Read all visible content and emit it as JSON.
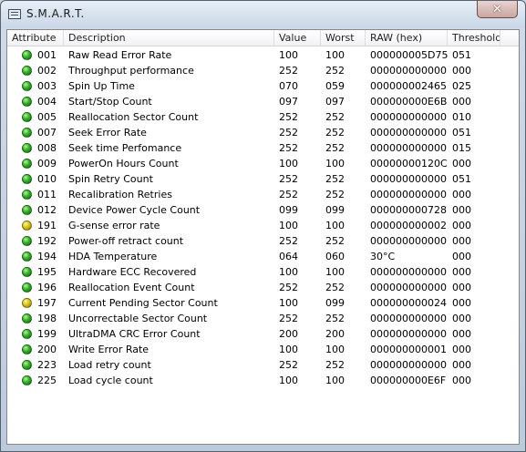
{
  "window": {
    "title": "S.M.A.R.T.",
    "close_label": "✕"
  },
  "columns": [
    "Attribute",
    "Description",
    "Value",
    "Worst",
    "RAW (hex)",
    "Threshold"
  ],
  "colors": {
    "ok": "#33b02a",
    "warning": "#d7c21a"
  },
  "rows": [
    {
      "status": "ok",
      "attr": "001",
      "desc": "Raw Read Error Rate",
      "value": "100",
      "worst": "100",
      "raw": "000000005D75",
      "threshold": "051"
    },
    {
      "status": "ok",
      "attr": "002",
      "desc": "Throughput performance",
      "value": "252",
      "worst": "252",
      "raw": "000000000000",
      "threshold": "000"
    },
    {
      "status": "ok",
      "attr": "003",
      "desc": "Spin Up Time",
      "value": "070",
      "worst": "059",
      "raw": "000000002465",
      "threshold": "025"
    },
    {
      "status": "ok",
      "attr": "004",
      "desc": "Start/Stop Count",
      "value": "097",
      "worst": "097",
      "raw": "000000000E6B",
      "threshold": "000"
    },
    {
      "status": "ok",
      "attr": "005",
      "desc": "Reallocation Sector Count",
      "value": "252",
      "worst": "252",
      "raw": "000000000000",
      "threshold": "010"
    },
    {
      "status": "ok",
      "attr": "007",
      "desc": "Seek Error Rate",
      "value": "252",
      "worst": "252",
      "raw": "000000000000",
      "threshold": "051"
    },
    {
      "status": "ok",
      "attr": "008",
      "desc": "Seek time Perfomance",
      "value": "252",
      "worst": "252",
      "raw": "000000000000",
      "threshold": "015"
    },
    {
      "status": "ok",
      "attr": "009",
      "desc": "PowerOn Hours Count",
      "value": "100",
      "worst": "100",
      "raw": "00000000120C",
      "threshold": "000"
    },
    {
      "status": "ok",
      "attr": "010",
      "desc": "Spin Retry Count",
      "value": "252",
      "worst": "252",
      "raw": "000000000000",
      "threshold": "051"
    },
    {
      "status": "ok",
      "attr": "011",
      "desc": "Recalibration Retries",
      "value": "252",
      "worst": "252",
      "raw": "000000000000",
      "threshold": "000"
    },
    {
      "status": "ok",
      "attr": "012",
      "desc": "Device Power Cycle Count",
      "value": "099",
      "worst": "099",
      "raw": "000000000728",
      "threshold": "000"
    },
    {
      "status": "warning",
      "attr": "191",
      "desc": "G-sense error rate",
      "value": "100",
      "worst": "100",
      "raw": "000000000002",
      "threshold": "000"
    },
    {
      "status": "ok",
      "attr": "192",
      "desc": "Power-off retract count",
      "value": "252",
      "worst": "252",
      "raw": "000000000000",
      "threshold": "000"
    },
    {
      "status": "ok",
      "attr": "194",
      "desc": "HDA Temperature",
      "value": "064",
      "worst": "060",
      "raw": "30°C",
      "threshold": "000"
    },
    {
      "status": "ok",
      "attr": "195",
      "desc": "Hardware ECC Recovered",
      "value": "100",
      "worst": "100",
      "raw": "000000000000",
      "threshold": "000"
    },
    {
      "status": "ok",
      "attr": "196",
      "desc": "Reallocation Event Count",
      "value": "252",
      "worst": "252",
      "raw": "000000000000",
      "threshold": "000"
    },
    {
      "status": "warning",
      "attr": "197",
      "desc": "Current Pending Sector Count",
      "value": "100",
      "worst": "099",
      "raw": "000000000024",
      "threshold": "000"
    },
    {
      "status": "ok",
      "attr": "198",
      "desc": "Uncorrectable Sector Count",
      "value": "252",
      "worst": "252",
      "raw": "000000000000",
      "threshold": "000"
    },
    {
      "status": "ok",
      "attr": "199",
      "desc": "UltraDMA CRC Error Count",
      "value": "200",
      "worst": "200",
      "raw": "000000000000",
      "threshold": "000"
    },
    {
      "status": "ok",
      "attr": "200",
      "desc": "Write Error Rate",
      "value": "100",
      "worst": "100",
      "raw": "000000000001",
      "threshold": "000"
    },
    {
      "status": "ok",
      "attr": "223",
      "desc": "Load retry count",
      "value": "252",
      "worst": "252",
      "raw": "000000000000",
      "threshold": "000"
    },
    {
      "status": "ok",
      "attr": "225",
      "desc": "Load cycle count",
      "value": "100",
      "worst": "100",
      "raw": "000000000E6F",
      "threshold": "000"
    }
  ]
}
